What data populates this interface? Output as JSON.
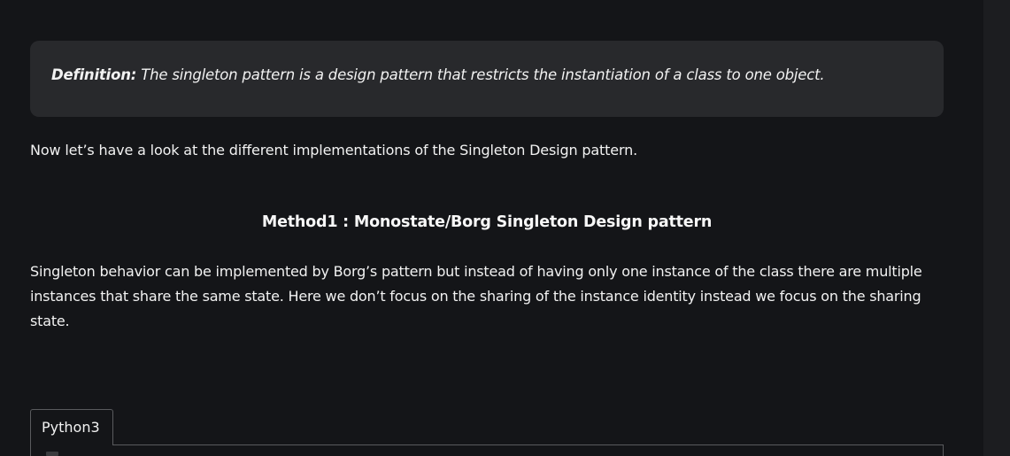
{
  "definition": {
    "label": "Definition:",
    "text": " The singleton pattern is a design pattern that restricts the instantiation of a class to one object."
  },
  "intro": "Now let’s have a look at the different implementations of the Singleton Design pattern.",
  "method1": {
    "heading": "Method1 : Monostate/Borg Singleton Design pattern",
    "paragraph": "Singleton behavior can be implemented by Borg’s pattern but instead of having only one instance of the class there are multiple instances that share the same state. Here we don’t focus on the sharing of the instance identity instead we focus on the sharing state."
  },
  "code_tabs": [
    {
      "label": "Python3",
      "selected": true
    }
  ]
}
